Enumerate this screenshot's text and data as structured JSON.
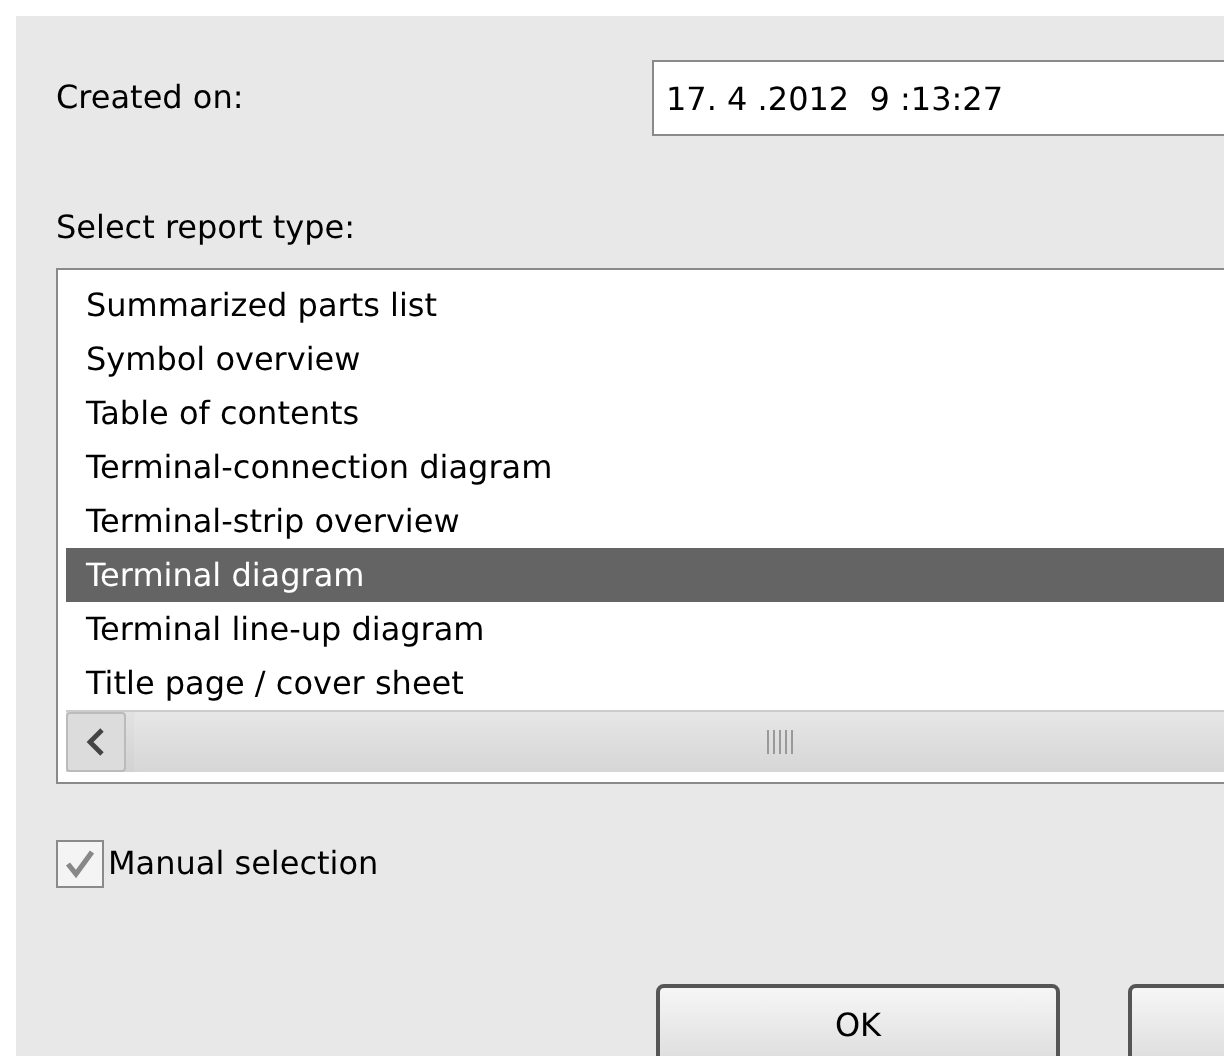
{
  "created_on": {
    "label": "Created on:",
    "value": "17. 4 .2012  9 :13:27"
  },
  "report_type": {
    "label": "Select report type:",
    "items": [
      {
        "label": "Summarized parts list",
        "selected": false
      },
      {
        "label": "Symbol overview",
        "selected": false
      },
      {
        "label": "Table of contents",
        "selected": false
      },
      {
        "label": "Terminal-connection diagram",
        "selected": false
      },
      {
        "label": "Terminal-strip overview",
        "selected": false
      },
      {
        "label": "Terminal diagram",
        "selected": true
      },
      {
        "label": "Terminal line-up diagram",
        "selected": false
      },
      {
        "label": "Title page / cover sheet",
        "selected": false
      }
    ]
  },
  "manual_selection": {
    "label": "Manual selection",
    "checked": true
  },
  "buttons": [
    "OK"
  ]
}
